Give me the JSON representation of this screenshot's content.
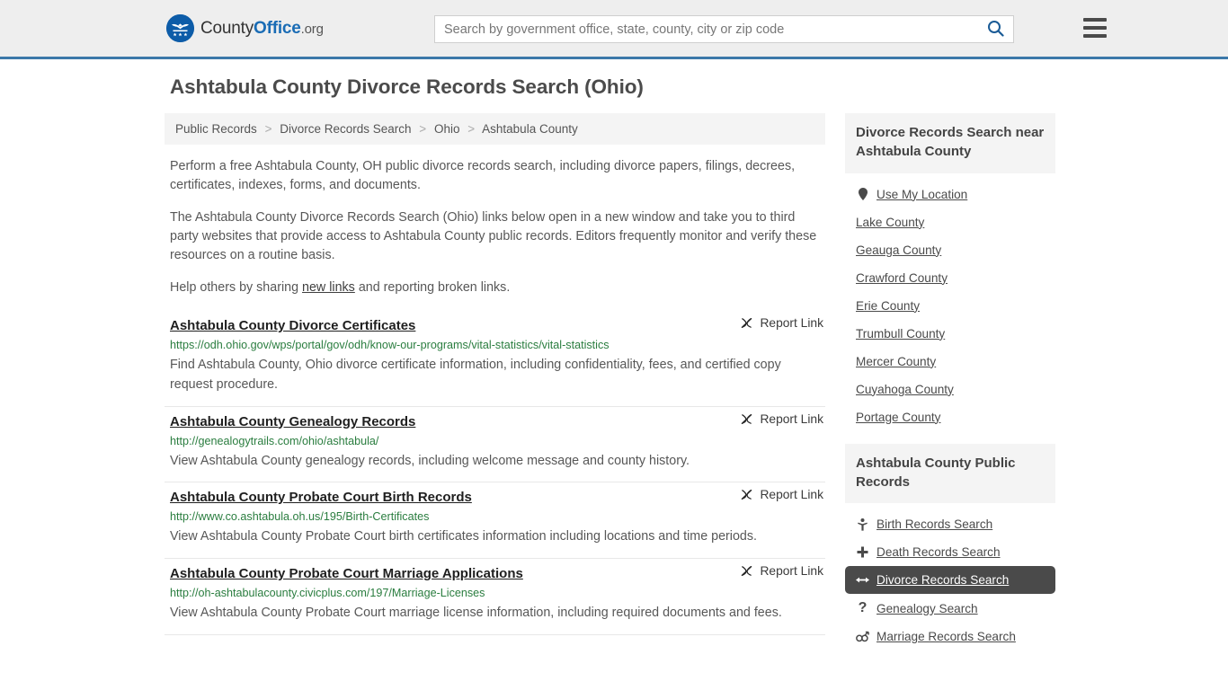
{
  "header": {
    "brand": {
      "county": "County",
      "office": "Office",
      "org": ".org"
    },
    "search": {
      "placeholder": "Search by government office, state, county, city or zip code",
      "value": "",
      "search_icon": "search-icon"
    },
    "menu_icon": "hamburger-menu-icon"
  },
  "page": {
    "title": "Ashtabula County Divorce Records Search (Ohio)"
  },
  "breadcrumb": {
    "items": [
      {
        "label": "Public Records"
      },
      {
        "label": "Divorce Records Search"
      },
      {
        "label": "Ohio"
      },
      {
        "label": "Ashtabula County"
      }
    ],
    "separator": ">"
  },
  "intro": {
    "p1": "Perform a free Ashtabula County, OH public divorce records search, including divorce papers, filings, decrees, certificates, indexes, forms, and documents.",
    "p2": "The Ashtabula County Divorce Records Search (Ohio) links below open in a new window and take you to third party websites that provide access to Ashtabula County public records. Editors frequently monitor and verify these resources on a routine basis.",
    "p3_before": "Help others by sharing ",
    "p3_link": "new links",
    "p3_after": " and reporting broken links."
  },
  "results": {
    "report_label": "Report Link",
    "report_icon": "broken-link-icon",
    "items": [
      {
        "title": "Ashtabula County Divorce Certificates",
        "url": "https://odh.ohio.gov/wps/portal/gov/odh/know-our-programs/vital-statistics/vital-statistics",
        "description": "Find Ashtabula County, Ohio divorce certificate information, including confidentiality, fees, and certified copy request procedure."
      },
      {
        "title": "Ashtabula County Genealogy Records",
        "url": "http://genealogytrails.com/ohio/ashtabula/",
        "description": "View Ashtabula County genealogy records, including welcome message and county history."
      },
      {
        "title": "Ashtabula County Probate Court Birth Records",
        "url": "http://www.co.ashtabula.oh.us/195/Birth-Certificates",
        "description": "View Ashtabula County Probate Court birth certificates information including locations and time periods."
      },
      {
        "title": "Ashtabula County Probate Court Marriage Applications",
        "url": "http://oh-ashtabulacounty.civicplus.com/197/Marriage-Licenses",
        "description": "View Ashtabula County Probate Court marriage license information, including required documents and fees."
      }
    ]
  },
  "sidebar": {
    "nearby": {
      "heading": "Divorce Records Search near Ashtabula County",
      "items": [
        {
          "label": "Use My Location",
          "icon": "map-pin-icon"
        },
        {
          "label": "Lake County",
          "icon": ""
        },
        {
          "label": "Geauga County",
          "icon": ""
        },
        {
          "label": "Crawford County",
          "icon": ""
        },
        {
          "label": "Erie County",
          "icon": ""
        },
        {
          "label": "Trumbull County",
          "icon": ""
        },
        {
          "label": "Mercer County",
          "icon": ""
        },
        {
          "label": "Cuyahoga County",
          "icon": ""
        },
        {
          "label": "Portage County",
          "icon": ""
        }
      ]
    },
    "public_records": {
      "heading": "Ashtabula County Public Records",
      "items": [
        {
          "label": "Birth Records Search",
          "icon": "baby-icon",
          "glyph": "🚼",
          "active": false
        },
        {
          "label": "Death Records Search",
          "icon": "cross-icon",
          "glyph": "✚",
          "active": false
        },
        {
          "label": "Divorce Records Search",
          "icon": "left-right-arrow-icon",
          "glyph": "↔",
          "active": true
        },
        {
          "label": "Genealogy Search",
          "icon": "question-mark-icon",
          "glyph": "?",
          "active": false
        },
        {
          "label": "Marriage Records Search",
          "icon": "male-female-icon",
          "glyph": "⚥",
          "active": false
        }
      ]
    }
  },
  "colors": {
    "header_bg": "#eeeeee",
    "header_border": "#3c78a9",
    "brand_blue": "#1a6cb5",
    "logo_blue": "#0d5ca8",
    "url_green": "#2a7d3f",
    "active_bg": "#4a4a4a",
    "panel_bg": "#f4f4f4"
  }
}
